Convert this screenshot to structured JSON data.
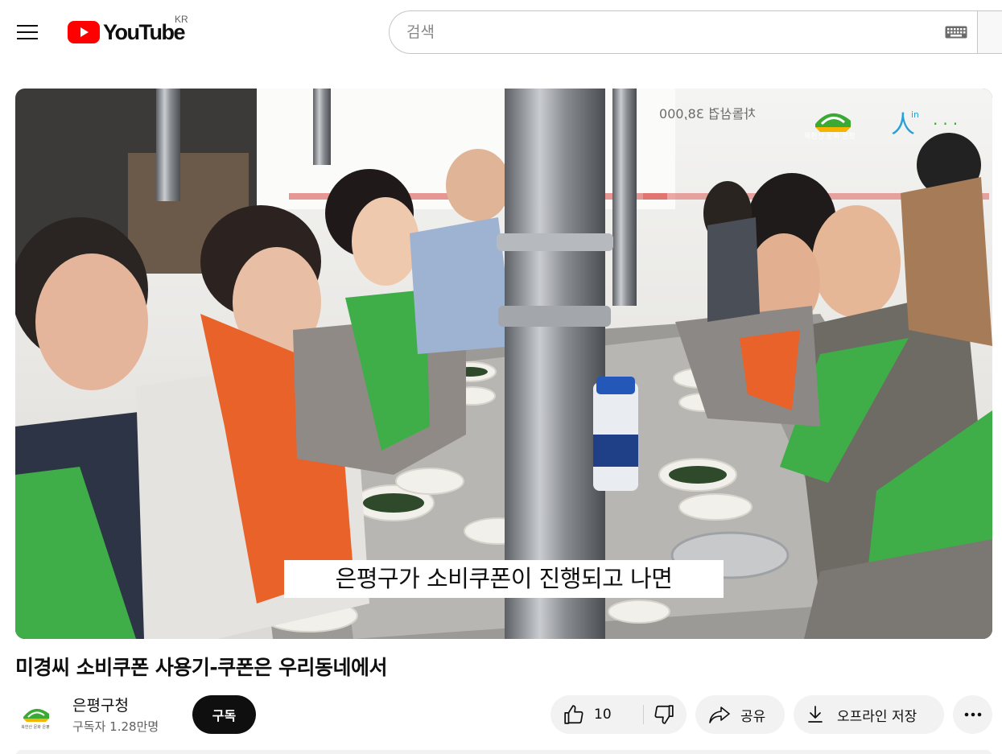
{
  "header": {
    "logo_text": "YouTube",
    "country_code": "KR",
    "search_placeholder": "검색"
  },
  "video": {
    "caption": "은평구가 소비쿠폰이 진행되고 나면",
    "overlay_brand": "북한산 문화 은평",
    "overlay_in_text": "人",
    "overlay_in_sub": "in",
    "title": "미경씨 소비쿠폰 사용기-쿠폰은 우리동네에서"
  },
  "channel": {
    "name": "은평구청",
    "subscribers": "구독자 1.28만명",
    "avatar_text": "북한산 문화 은평",
    "subscribe_label": "구독"
  },
  "actions": {
    "like_count": "10",
    "share_label": "공유",
    "download_label": "오프라인 저장"
  },
  "colors": {
    "youtube_red": "#ff0000",
    "button_bg": "#f2f2f2",
    "subscribe_bg": "#0f0f0f",
    "apron_orange": "#e8622a",
    "apron_green": "#3fae48"
  },
  "icons": {
    "menu": "hamburger-menu-icon",
    "keyboard": "keyboard-icon",
    "like": "thumbs-up-icon",
    "dislike": "thumbs-down-icon",
    "share": "share-arrow-icon",
    "download": "download-icon",
    "more": "more-horizontal-icon"
  }
}
